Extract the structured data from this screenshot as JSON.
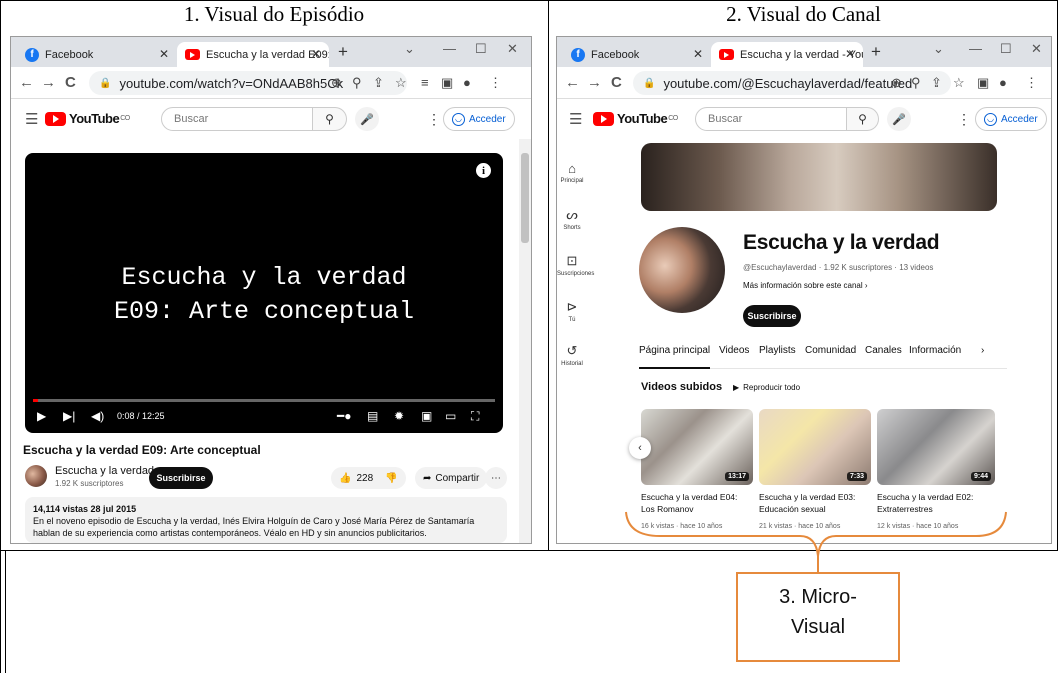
{
  "captions": {
    "left": "1. Visual do Episódio",
    "right": "2. Visual do Canal",
    "micro": "3. Micro-\nVisual"
  },
  "colors": {
    "accent": "#e68a3c",
    "yt_red": "#ff0000",
    "link_blue": "#065fd4"
  },
  "left": {
    "tabs": [
      {
        "icon": "facebook-icon",
        "label": "Facebook"
      },
      {
        "icon": "youtube-icon",
        "label": "Escucha y la verdad E09:"
      }
    ],
    "url": "youtube.com/watch?v=ONdAAB8h5Ck",
    "search_placeholder": "Buscar",
    "signin": "Acceder",
    "player_title_line1": "Escucha y la verdad",
    "player_title_line2": "E09: Arte conceptual",
    "time": "0:08 / 12:25",
    "progress": 0.011,
    "video_title": "Escucha y la verdad E09: Arte conceptual",
    "channel_name": "Escucha y la verdad",
    "subscribers": "1.92 K suscriptores",
    "subscribe_label": "Suscribirse",
    "likes": "228",
    "share_label": "Compartir",
    "desc_meta": "14,114 vistas  28 jul 2015",
    "desc_text": "En el noveno episodio de Escucha y la verdad, Inés Elvira Holguín de Caro y José María Pérez de Santamaría hablan de su experiencia como artistas contemporáneos. Véalo en HD y sin anuncios publicitarios."
  },
  "right": {
    "tabs": [
      {
        "icon": "facebook-icon",
        "label": "Facebook"
      },
      {
        "icon": "youtube-icon",
        "label": "Escucha y la verdad - You"
      }
    ],
    "url": "youtube.com/@Escuchaylaverdad/featured",
    "search_placeholder": "Buscar",
    "signin": "Acceder",
    "sidebar": [
      {
        "icon": "home-icon",
        "label": "Principal"
      },
      {
        "icon": "shorts-icon",
        "label": "Shorts"
      },
      {
        "icon": "subscriptions-icon",
        "label": "Suscripciones"
      },
      {
        "icon": "library-icon",
        "label": "Tú"
      },
      {
        "icon": "history-icon",
        "label": "Historial"
      }
    ],
    "channel_title": "Escucha y la verdad",
    "channel_meta": "@Escuchaylaverdad · 1.92 K suscriptores · 13 videos",
    "channel_more": "Más información sobre este canal  ›",
    "subscribe_label": "Suscribirse",
    "nav_tabs": [
      "Página principal",
      "Videos",
      "Playlists",
      "Comunidad",
      "Canales",
      "Información"
    ],
    "section_title": "Videos subidos",
    "play_all": "Reproducir todo",
    "videos": [
      {
        "title": "Escucha y la verdad E04: Los Romanov",
        "meta": "16 k vistas · hace 10 años",
        "duration": "13:17"
      },
      {
        "title": "Escucha y la verdad E03: Educación sexual",
        "meta": "21 k vistas · hace 10 años",
        "duration": "7:33"
      },
      {
        "title": "Escucha y la verdad E02: Extraterrestres",
        "meta": "12 k vistas · hace 10 años",
        "duration": "9:44"
      }
    ]
  }
}
